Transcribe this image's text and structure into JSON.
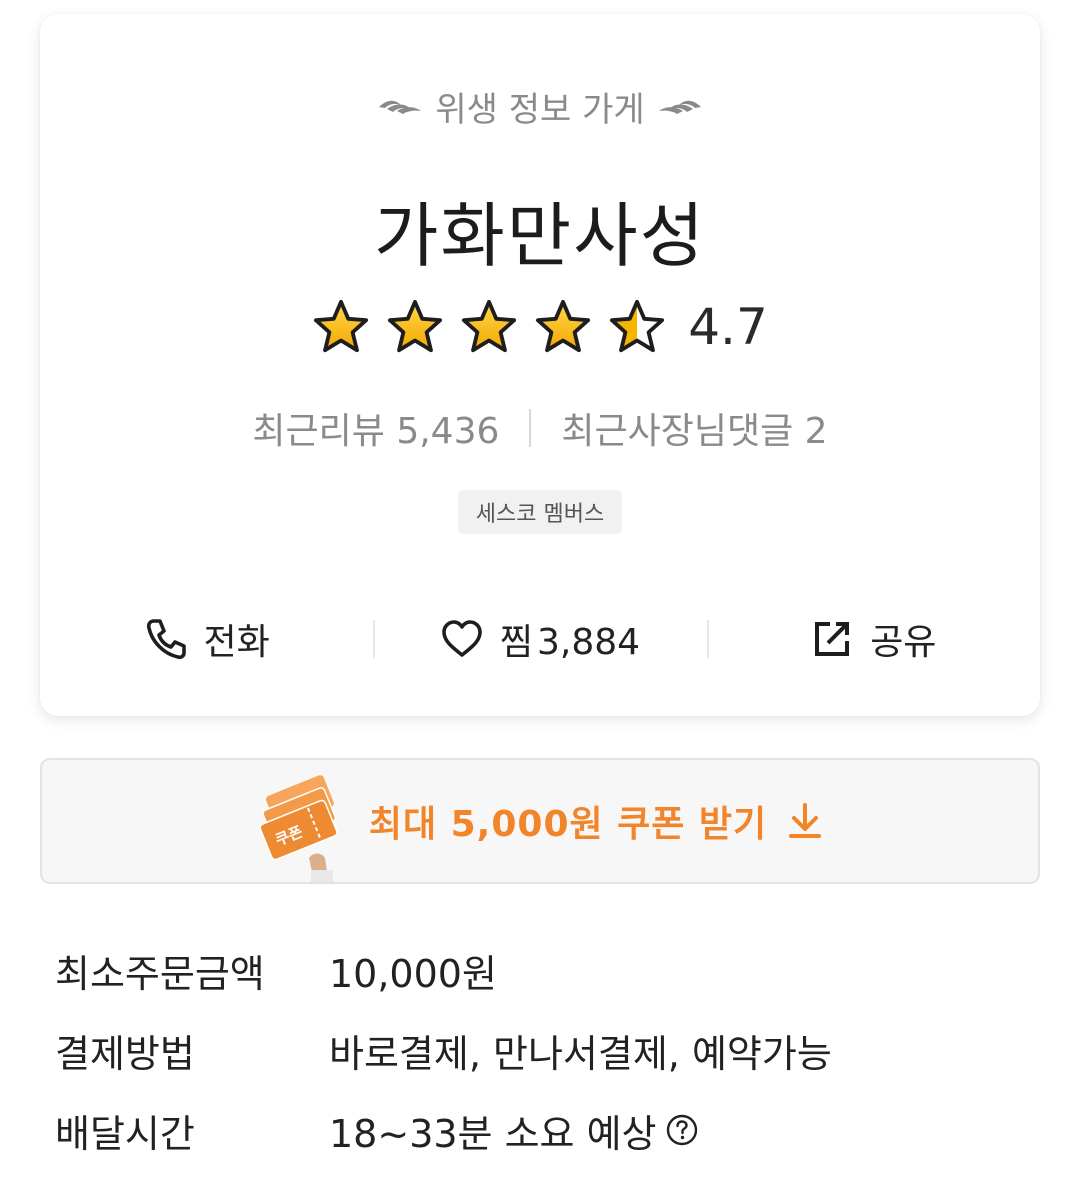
{
  "store": {
    "hygiene_label": "위생 정보 가게",
    "name": "가화만사성",
    "rating": "4.7",
    "rating_stars": 4.5,
    "recent_reviews": "최근리뷰 5,436",
    "owner_replies": "최근사장님댓글 2",
    "badge": "세스코 멤버스"
  },
  "actions": {
    "call_label": "전화",
    "like_label": "찜",
    "like_count": "3,884",
    "share_label": "공유"
  },
  "coupon": {
    "illustration_text": "쿠폰",
    "label": "최대 5,000원 쿠폰 받기",
    "accent_color": "#f2842a"
  },
  "info": {
    "rows": [
      {
        "label": "최소주문금액",
        "value": "10,000원"
      },
      {
        "label": "결제방법",
        "value": "바로결제, 만나서결제, 예약가능"
      },
      {
        "label": "배달시간",
        "value": "18~33분 소요 예상"
      }
    ]
  },
  "icons": [
    "laurel-left-icon",
    "laurel-right-icon",
    "star-icon",
    "half-star-icon",
    "phone-icon",
    "heart-icon",
    "share-icon",
    "download-arrow-icon",
    "help-icon"
  ]
}
